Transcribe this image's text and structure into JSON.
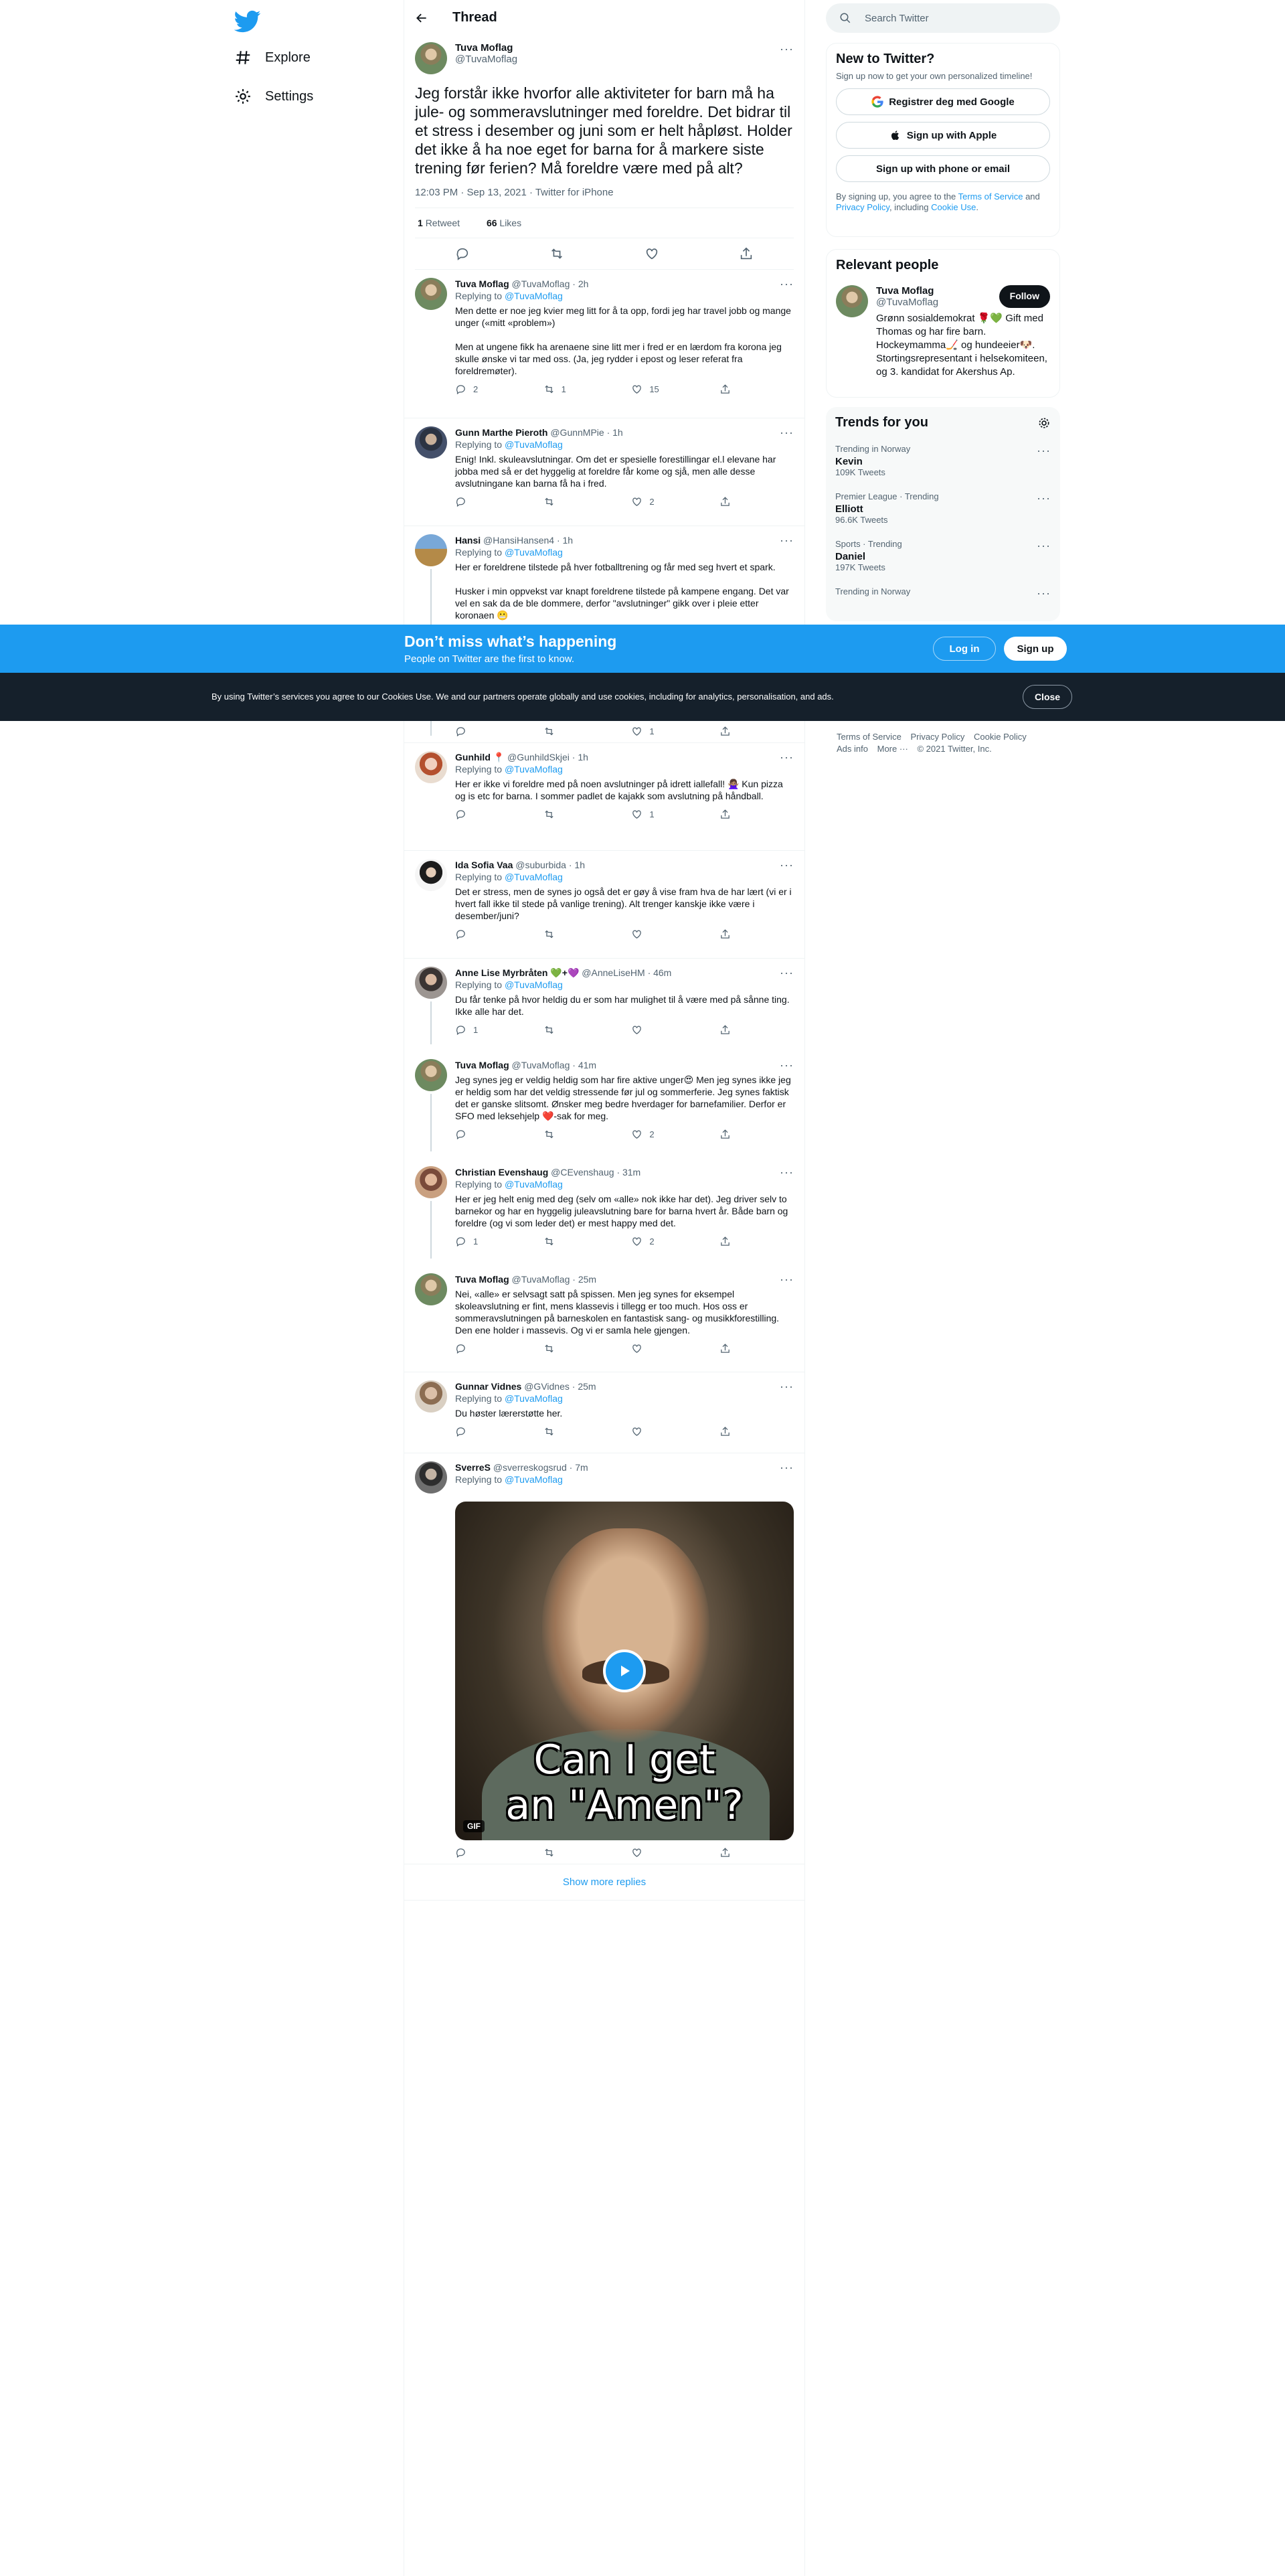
{
  "nav": {
    "explore": "Explore",
    "settings": "Settings"
  },
  "header": {
    "title": "Thread"
  },
  "focal": {
    "name": "Tuva Moflag",
    "handle": "@TuvaMoflag",
    "text": "Jeg forstår ikke hvorfor alle aktiviteter for barn må ha jule- og sommeravslutninger med foreldre. Det bidrar til et stress i desember og juni som er helt håpløst. Holder det ikke å ha noe eget for barna for å markere siste trening før ferien? Må foreldre være med på alt?",
    "meta": "12:03 PM · Sep 13, 2021 · Twitter for iPhone",
    "retweets_count": "1",
    "retweets_label": "Retweet",
    "likes_count": "66",
    "likes_label": "Likes"
  },
  "replying_label": "Replying to",
  "replying_handle": "@TuvaMoflag",
  "replies": [
    {
      "name": "Tuva Moflag",
      "handle": "@TuvaMoflag",
      "time": "· 2h",
      "text": "Men dette er noe jeg kvier meg litt for å ta opp, fordi jeg har travel jobb og mange unger («mitt «problem»)\n\nMen at ungene fikk ha arenaene sine litt mer i fred er en lærdom fra korona jeg skulle ønske vi tar med oss. (Ja, jeg rydder i epost og leser referat fra foreldremøter).",
      "reply_count": "2",
      "rt_count": "1",
      "like_count": "15"
    },
    {
      "name": "Gunn Marthe Pieroth",
      "handle": "@GunnMPie",
      "time": "· 1h",
      "text": "Enig! Inkl. skuleavslutningar. Om det er spesielle forestillingar el.l elevane har jobba med så er det hyggelig at foreldre får kome og sjå, men alle desse avslutningane kan barna få ha i fred.",
      "reply_count": "",
      "rt_count": "",
      "like_count": "2"
    },
    {
      "name": "Hansi",
      "handle": "@HansiHansen4",
      "time": "· 1h",
      "text": "Her er foreldrene tilstede på hver fotballtrening og får med seg hvert et spark.\n\nHusker i min oppvekst var knapt foreldrene tilstede på kampene engang. Det var vel en sak da de ble dommere, derfor \"avslutninger\" gikk over i pleie etter koronaen 😬",
      "reply_count": "",
      "rt_count": "",
      "like_count": "1"
    },
    {
      "name": "Gunhild 📍",
      "handle": "@GunhildSkjei",
      "time": "· 1h",
      "text": "Her er ikke vi foreldre med på noen avslutninger på idrett iallefall! 🙅🏽‍♀️ Kun pizza og is etc for barna. I sommer padlet de kajakk som avslutning på håndball.",
      "reply_count": "",
      "rt_count": "",
      "like_count": "1"
    },
    {
      "name": "Ida Sofia Vaa",
      "handle": "@suburbida",
      "time": "· 1h",
      "text": "Det er stress, men de synes jo også det er gøy å vise fram hva de har lært (vi er i hvert fall ikke til stede på vanlige trening). Alt trenger kanskje ikke være i desember/juni?",
      "reply_count": "",
      "rt_count": "",
      "like_count": ""
    },
    {
      "name": "Anne Lise Myrbråten 💚+💜",
      "handle": "@AnneLiseHM",
      "time": "· 46m",
      "text": "Du får tenke på hvor heldig du er som har mulighet til å være med på sånne ting. Ikke alle har det.",
      "reply_count": "1",
      "rt_count": "",
      "like_count": ""
    },
    {
      "name": "Tuva Moflag",
      "handle": "@TuvaMoflag",
      "time": "· 41m",
      "text": "Jeg synes jeg er veldig heldig som har fire aktive unger😍 Men jeg synes ikke jeg er heldig som har det veldig stressende før jul og sommerferie. Jeg synes faktisk det er ganske slitsomt. Ønsker meg bedre hverdager for barnefamilier. Derfor er SFO med leksehjelp ❤️-sak for meg.",
      "reply_count": "",
      "rt_count": "",
      "like_count": "2"
    },
    {
      "name": "Christian Evenshaug",
      "handle": "@CEvenshaug",
      "time": "· 31m",
      "text": "Her er jeg helt enig med deg (selv om «alle» nok ikke har det). Jeg driver selv to barnekor og har en hyggelig juleavslutning bare for barna hvert år. Både barn og foreldre (og vi som leder det) er mest happy med det.",
      "reply_count": "1",
      "rt_count": "",
      "like_count": "2"
    },
    {
      "name": "Tuva Moflag",
      "handle": "@TuvaMoflag",
      "time": "· 25m",
      "text": "Nei, «alle» er selvsagt satt på spissen. Men jeg synes for eksempel skoleavslutning er fint, mens klassevis i tillegg er too much. Hos oss er sommeravslutningen på barneskolen en fantastisk sang- og musikkforestilling. Den ene holder i massevis. Og vi er samla hele gjengen.",
      "reply_count": "",
      "rt_count": "",
      "like_count": ""
    },
    {
      "name": "Gunnar Vidnes",
      "handle": "@GVidnes",
      "time": "· 25m",
      "text": "Du høster lærerstøtte her.",
      "reply_count": "",
      "rt_count": "",
      "like_count": ""
    },
    {
      "name": "SverreS",
      "handle": "@sverreskogsrud",
      "time": "· 7m",
      "text": "",
      "reply_count": "",
      "rt_count": "",
      "like_count": ""
    }
  ],
  "gif": {
    "caption_line1": "Can I get",
    "caption_line2": "an \"Amen\"?",
    "badge": "GIF"
  },
  "show_more": "Show more replies",
  "sidebar": {
    "search_placeholder": "Search Twitter",
    "new_title": "New to Twitter?",
    "new_sub": "Sign up now to get your own personalized timeline!",
    "google_btn": "Registrer deg med Google",
    "apple_btn": "Sign up with Apple",
    "phone_btn": "Sign up with phone or email",
    "terms_prefix": "By signing up, you agree to the",
    "terms_link": "Terms of Service",
    "terms_and": "and",
    "privacy_link": "Privacy Policy",
    "terms_including": ", including",
    "cookie_link": "Cookie Use",
    "relevant_title": "Relevant people",
    "person_name": "Tuva Moflag",
    "person_handle": "@TuvaMoflag",
    "follow_label": "Follow",
    "person_bio": "Grønn sosialdemokrat 🌹💚 Gift med Thomas og har fire barn. Hockeymamma🏒 og hundeeier🐶. Stortingsrepresentant i helsekomiteen, og 3. kandidat for Akershus Ap.",
    "trends_title": "Trends for you",
    "trends": [
      {
        "context": "Trending in Norway",
        "name": "Kevin",
        "count": "109K Tweets"
      },
      {
        "context": "Premier League · Trending",
        "name": "Elliott",
        "count": "96.6K Tweets"
      },
      {
        "context": "Sports · Trending",
        "name": "Daniel",
        "count": "197K Tweets"
      },
      {
        "context": "Trending in Norway",
        "name": "",
        "count": ""
      }
    ],
    "footer": [
      "Terms of Service",
      "Privacy Policy",
      "Cookie Policy",
      "Ads info",
      "More ···",
      "© 2021 Twitter, Inc."
    ]
  },
  "signup_bar": {
    "title": "Don’t miss what’s happening",
    "sub": "People on Twitter are the first to know.",
    "login": "Log in",
    "signup": "Sign up"
  },
  "cookie_bar": {
    "text": "By using Twitter’s services you agree to our Cookies Use. We and our partners operate globally and use cookies, including for analytics, personalisation, and ads.",
    "close": "Close"
  },
  "colors": {
    "accent": "#1d9bf0",
    "text": "#0f1419",
    "muted": "#536471",
    "border": "#eff3f4"
  }
}
